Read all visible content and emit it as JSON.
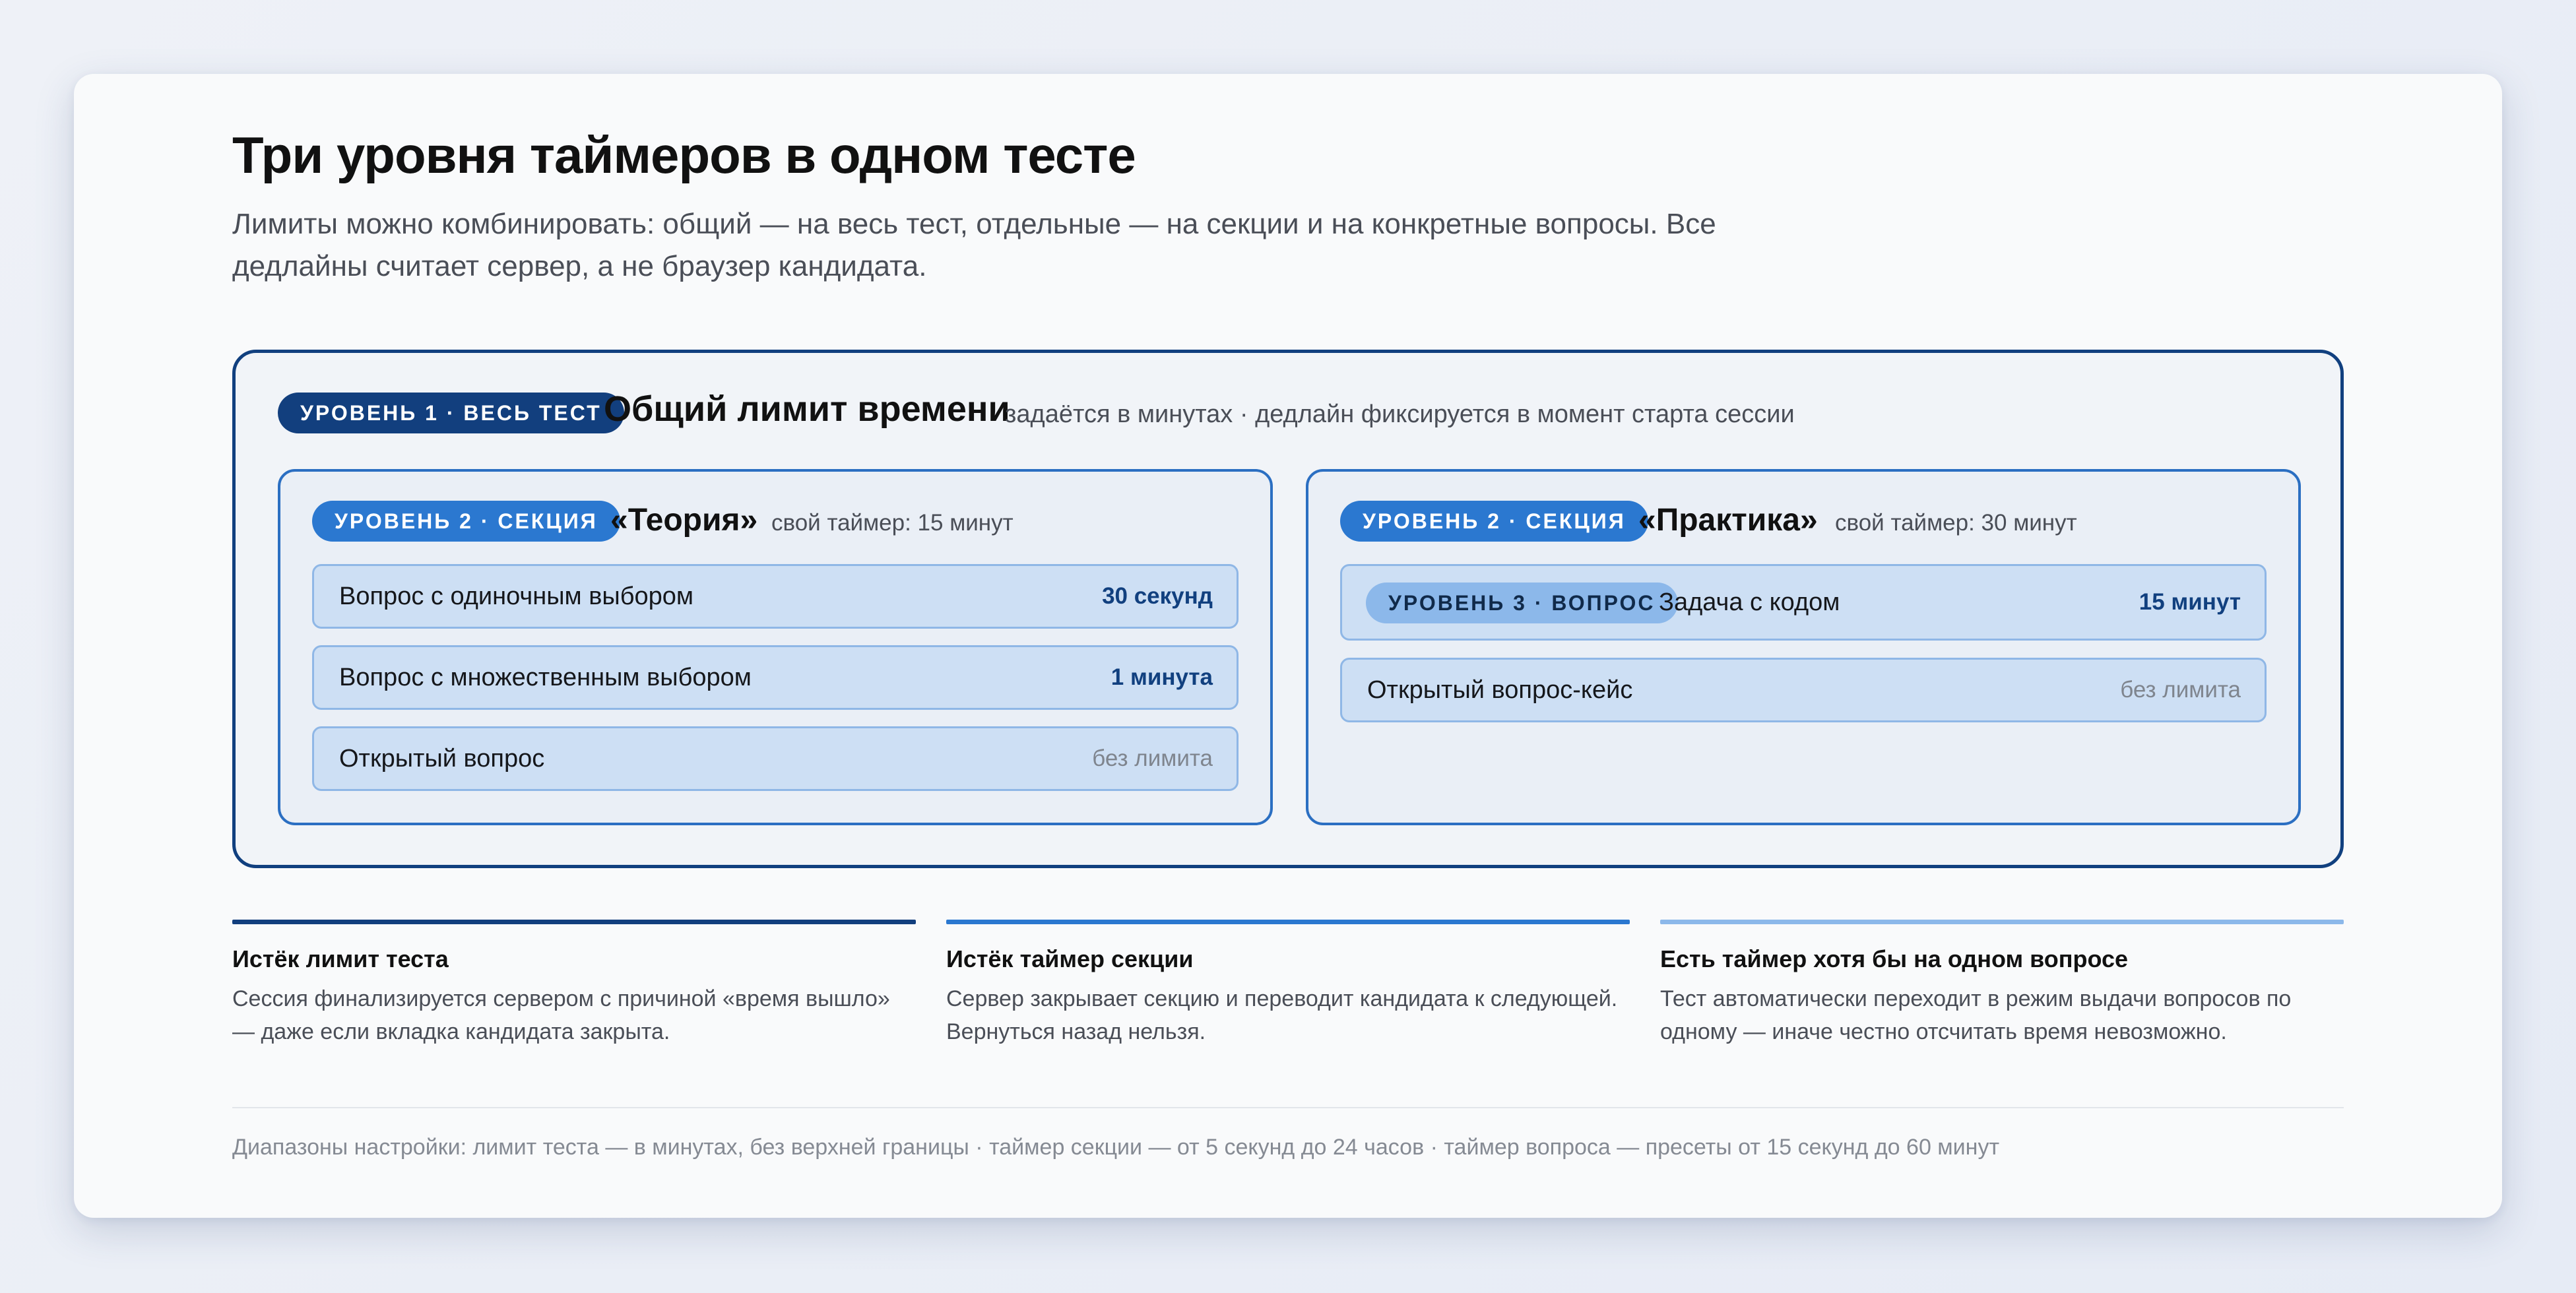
{
  "header": {
    "title": "Три уровня таймеров в одном тесте",
    "subtitle": "Лимиты можно комбинировать: общий — на весь тест, отдельные — на секции и на конкретные вопросы. Все дедлайны считает сервер, а не браузер кандидата."
  },
  "level1": {
    "badge": "УРОВЕНЬ 1 · ВЕСЬ ТЕСТ",
    "title": "Общий лимит времени",
    "note": "задаётся в минутах · дедлайн фиксируется в момент старта сессии"
  },
  "sections": [
    {
      "badge": "УРОВЕНЬ 2 · СЕКЦИЯ",
      "name": "«Теория»",
      "timer": "свой таймер: 15 минут",
      "questions": [
        {
          "label": "Вопрос с одиночным выбором",
          "limit": "30 секунд"
        },
        {
          "label": "Вопрос с множественным выбором",
          "limit": "1 минута"
        },
        {
          "label": "Открытый вопрос",
          "limit": "без лимита"
        }
      ]
    },
    {
      "badge": "УРОВЕНЬ 2 · СЕКЦИЯ",
      "name": "«Практика»",
      "timer": "свой таймер: 30 минут",
      "questions": [
        {
          "badge": "УРОВЕНЬ 3 · ВОПРОС",
          "label": "Задача с кодом",
          "limit": "15 минут"
        },
        {
          "label": "Открытый вопрос-кейс",
          "limit": "без лимита"
        }
      ]
    }
  ],
  "rules": [
    {
      "title": "Истёк лимит теста",
      "text": "Сессия финализируется сервером с причиной «время вышло» — даже если вкладка кандидата закрыта.",
      "color": "#123f7e"
    },
    {
      "title": "Истёк таймер секции",
      "text": "Сервер закрывает секцию и переводит кандидата к следующей. Вернуться назад нельзя.",
      "color": "#2b78d0"
    },
    {
      "title": "Есть таймер хотя бы на одном вопросе",
      "text": "Тест автоматически переходит в режим выдачи вопросов по одному — иначе честно отсчитать время невозможно.",
      "color": "#8cb8ea"
    }
  ],
  "footer": "Диапазоны настройки: лимит теста — в минутах, без верхней границы · таймер секции — от 5 секунд до 24 часов · таймер вопроса — пресеты от 15 секунд до 60 минут",
  "colors": {
    "level1": "#123f7e",
    "level2": "#2b78d0",
    "level3": "#8cb8ea",
    "question_bg": "#cddff4"
  }
}
